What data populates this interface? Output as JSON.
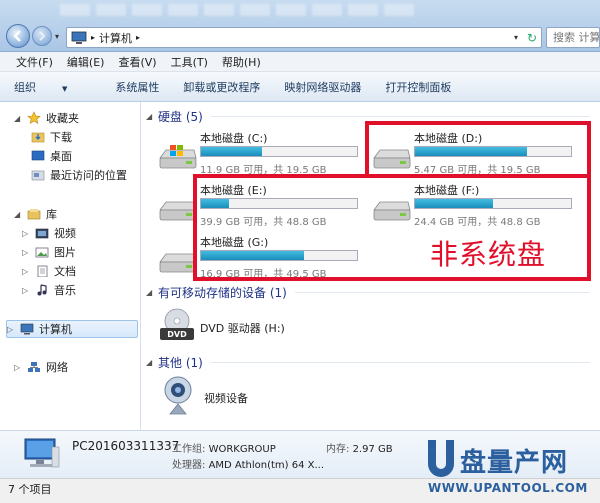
{
  "window": {
    "address_crumb": "计算机",
    "search_placeholder": "搜索 计算机"
  },
  "menu": [
    "文件(F)",
    "编辑(E)",
    "查看(V)",
    "工具(T)",
    "帮助(H)"
  ],
  "toolbar": {
    "organize": "组织",
    "system_props": "系统属性",
    "uninstall": "卸载或更改程序",
    "map_drive": "映射网络驱动器",
    "control_panel": "打开控制面板"
  },
  "nav": {
    "favorites": "收藏夹",
    "downloads": "下载",
    "desktop": "桌面",
    "recent": "最近访问的位置",
    "libraries": "库",
    "videos": "视频",
    "pictures": "图片",
    "documents": "文档",
    "music": "音乐",
    "computer": "计算机",
    "network": "网络"
  },
  "groups": {
    "hdd": "硬盘 (5)",
    "removable": "有可移动存储的设备 (1)",
    "other": "其他 (1)"
  },
  "drives": [
    {
      "name": "本地磁盘 (C:)",
      "size": "11.9 GB 可用，共 19.5 GB",
      "used": 0.39
    },
    {
      "name": "本地磁盘 (D:)",
      "size": "5.47 GB 可用，共 19.5 GB",
      "used": 0.72
    },
    {
      "name": "本地磁盘 (E:)",
      "size": "39.9 GB 可用，共 48.8 GB",
      "used": 0.18
    },
    {
      "name": "本地磁盘 (F:)",
      "size": "24.4 GB 可用，共 48.8 GB",
      "used": 0.5
    },
    {
      "name": "本地磁盘 (G:)",
      "size": "16.9 GB 可用，共 49.5 GB",
      "used": 0.66
    }
  ],
  "dvd": {
    "name": "DVD 驱动器 (H:)",
    "icon_label": "DVD"
  },
  "other_device": "视频设备",
  "annotation": "非系统盘",
  "details": {
    "pc_name": "PC201603311337",
    "workgroup_label": "工作组:",
    "workgroup": "WORKGROUP",
    "memory_label": "内存:",
    "memory": "2.97 GB",
    "cpu_label": "处理器:",
    "cpu": "AMD Athlon(tm) 64 X..."
  },
  "status": "7 个项目",
  "watermark": {
    "text1": "盘量产网",
    "text2": "WWW.UPANTOOL.COM"
  },
  "colors": {
    "accent": "#1e3287",
    "bar": "#26a3cf",
    "highlight": "#e0102a"
  }
}
